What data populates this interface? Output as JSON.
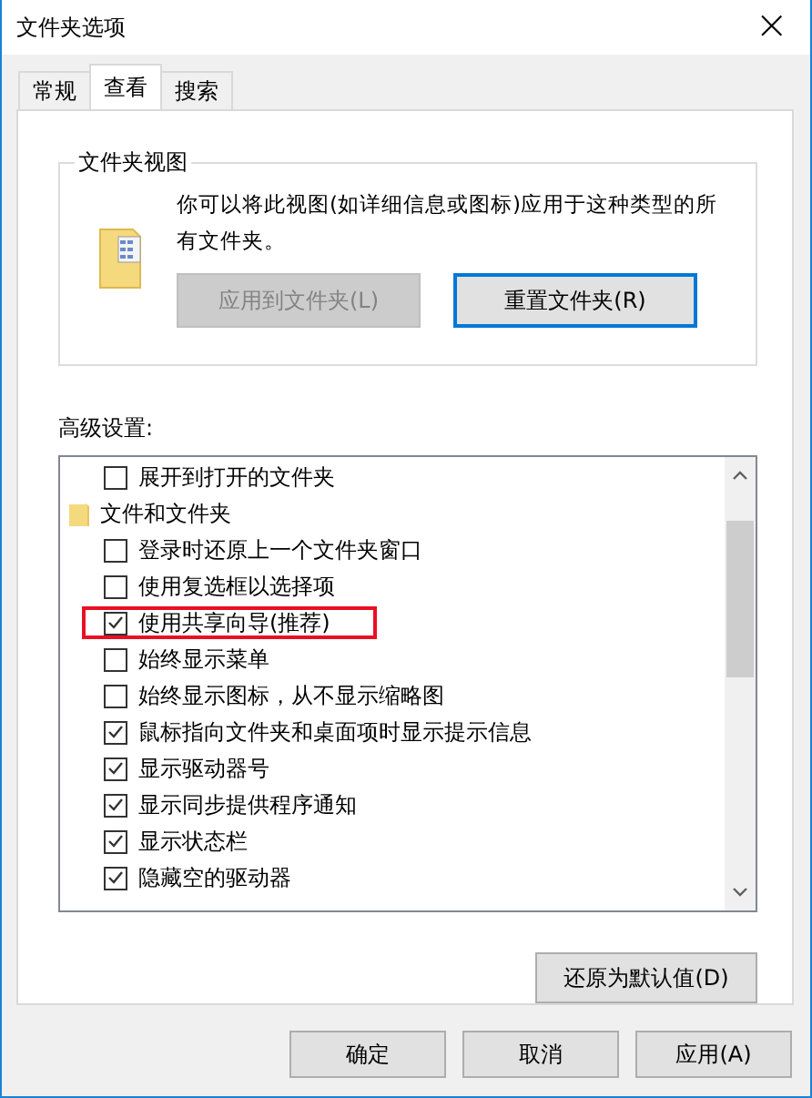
{
  "window": {
    "title": "文件夹选项",
    "close": "×"
  },
  "tabs": [
    {
      "label": "常规",
      "selected": false
    },
    {
      "label": "查看",
      "selected": true
    },
    {
      "label": "搜索",
      "selected": false
    }
  ],
  "folder_views": {
    "title": "文件夹视图",
    "description": "你可以将此视图(如详细信息或图标)应用于这种类型的所有文件夹。",
    "buttons": [
      {
        "label": "应用到文件夹(L)",
        "disabled": true,
        "focused": false
      },
      {
        "label": "重置文件夹(R)",
        "disabled": false,
        "focused": true
      }
    ]
  },
  "advanced": {
    "label": "高级设置:",
    "items": [
      {
        "kind": "checkbox",
        "label": "展开到打开的文件夹",
        "checked": false
      },
      {
        "kind": "folder",
        "label": "文件和文件夹",
        "children": [
          {
            "kind": "checkbox",
            "label": "登录时还原上一个文件夹窗口",
            "checked": false
          },
          {
            "kind": "checkbox",
            "label": "使用复选框以选择项",
            "checked": false
          },
          {
            "kind": "checkbox",
            "label": "使用共享向导(推荐)",
            "checked": true,
            "highlighted": true
          },
          {
            "kind": "checkbox",
            "label": "始终显示菜单",
            "checked": false
          },
          {
            "kind": "checkbox",
            "label": "始终显示图标，从不显示缩略图",
            "checked": false
          },
          {
            "kind": "checkbox",
            "label": "鼠标指向文件夹和桌面项时显示提示信息",
            "checked": true
          },
          {
            "kind": "checkbox",
            "label": "显示驱动器号",
            "checked": true
          },
          {
            "kind": "checkbox",
            "label": "显示同步提供程序通知",
            "checked": true
          },
          {
            "kind": "checkbox",
            "label": "显示状态栏",
            "checked": true
          },
          {
            "kind": "checkbox",
            "label": "隐藏空的驱动器",
            "checked": true
          }
        ]
      }
    ],
    "restore_button": "还原为默认值(D)"
  },
  "buttons": [
    "确定",
    "取消",
    "应用(A)"
  ]
}
